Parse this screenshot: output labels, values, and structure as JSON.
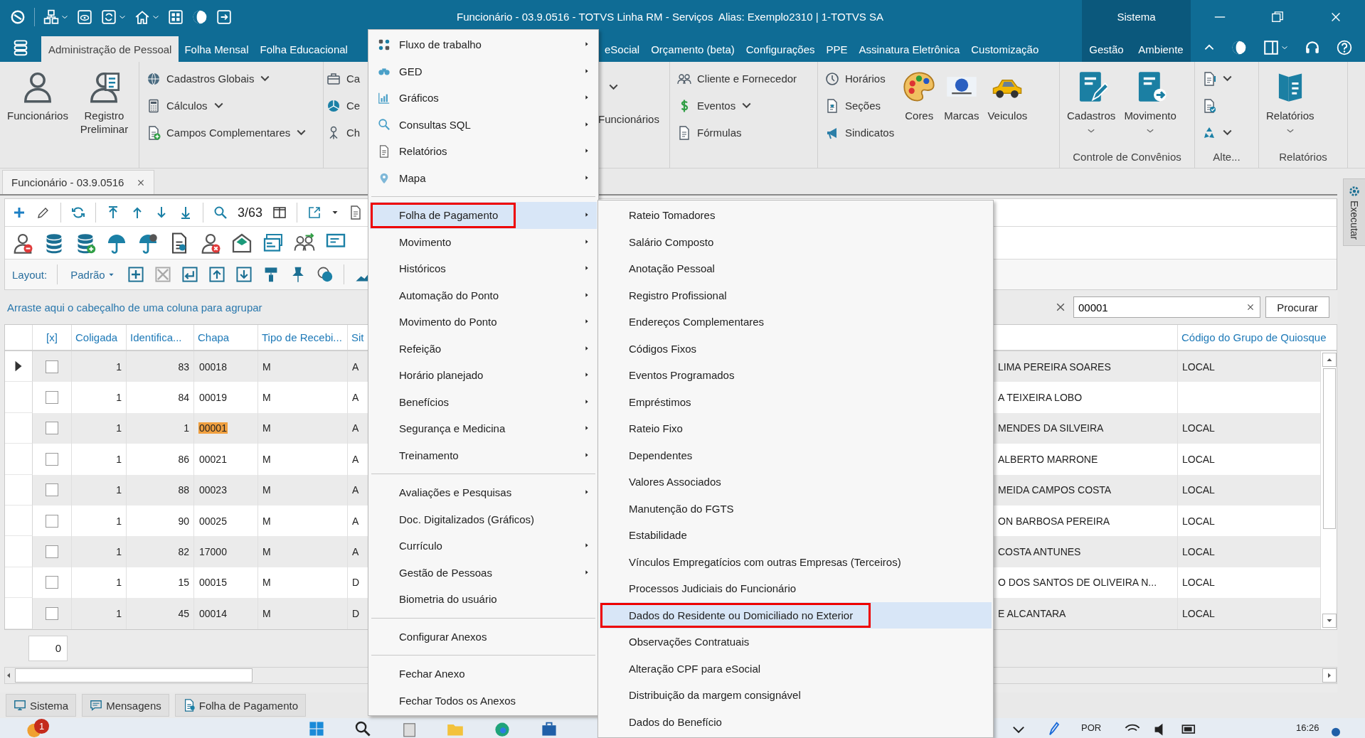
{
  "title_bar": {
    "title": "Funcionário - 03.9.0516 - TOTVS Linha RM - Serviços  Alias: Exemplo2310 | 1-TOTVS SA",
    "section": "Sistema"
  },
  "menu_tabs": [
    {
      "label": "Administração de Pessoal",
      "selected": true
    },
    {
      "label": "Folha Mensal",
      "selected": false
    },
    {
      "label": "Folha Educacional",
      "selected": false
    },
    {
      "label": "eSocial",
      "selected": false
    },
    {
      "label": "Orçamento (beta)",
      "selected": false
    },
    {
      "label": "Configurações",
      "selected": false
    },
    {
      "label": "PPE",
      "selected": false
    },
    {
      "label": "Assinatura Eletrônica",
      "selected": false
    },
    {
      "label": "Customização",
      "selected": false
    }
  ],
  "system_tabs": [
    {
      "label": "Gestão"
    },
    {
      "label": "Ambiente"
    }
  ],
  "ribbon": {
    "groups": [
      {
        "items": [
          {
            "label": "Funcionários",
            "kind": "large",
            "dropdown": false
          },
          {
            "label": "Registro Preliminar",
            "kind": "large",
            "dropdown": false
          }
        ]
      },
      {
        "items": [
          {
            "label": "Cadastros Globais",
            "kind": "small",
            "dropdown": true
          },
          {
            "label": "Cálculos",
            "kind": "small",
            "dropdown": true
          },
          {
            "label": "Campos Complementares",
            "kind": "small",
            "dropdown": true
          }
        ]
      },
      {
        "items": [
          {
            "label": "Ca",
            "kind": "small"
          },
          {
            "label": "Ce",
            "kind": "small",
            "dropdown": false
          },
          {
            "label": "Ch",
            "kind": "small",
            "dropdown": false
          },
          {
            "label": "Funcionários",
            "kind": "caption",
            "dropdown": true
          }
        ]
      },
      {
        "items": [
          {
            "label": "Cliente e Fornecedor",
            "kind": "small",
            "dropdown": false
          },
          {
            "label": "Eventos",
            "kind": "small",
            "dropdown": true
          },
          {
            "label": "Fórmulas",
            "kind": "small",
            "dropdown": false
          }
        ]
      },
      {
        "items": [
          {
            "label": "Horários",
            "kind": "small",
            "dropdown": false
          },
          {
            "label": "Seções",
            "kind": "small",
            "dropdown": false
          },
          {
            "label": "Sindicatos",
            "kind": "small",
            "dropdown": false
          },
          {
            "label": "Cores",
            "kind": "large",
            "dropdown": false
          },
          {
            "label": "Marcas",
            "kind": "large",
            "dropdown": false
          },
          {
            "label": "Veiculos",
            "kind": "large",
            "dropdown": false
          }
        ]
      },
      {
        "label": "Controle de Convênios",
        "items": [
          {
            "label": "Cadastros",
            "kind": "large",
            "dropdown": true
          },
          {
            "label": "Movimento",
            "kind": "large",
            "dropdown": true
          }
        ]
      },
      {
        "label": "Alte...",
        "items": [
          {
            "kind": "small",
            "dropdown": true
          },
          {
            "kind": "small",
            "dropdown": false
          },
          {
            "kind": "small",
            "dropdown": true
          }
        ]
      },
      {
        "label": "Relatórios",
        "items": [
          {
            "label": "Relatórios",
            "kind": "large",
            "dropdown": true
          }
        ]
      }
    ]
  },
  "document_tab": {
    "label": "Funcionário - 03.9.0516"
  },
  "toolbar": {
    "position": "3/63",
    "layout_label": "Layout:",
    "layout": "Padrão"
  },
  "group_hint": "Arraste aqui o cabeçalho de uma coluna para agrupar",
  "search": {
    "value": "00001",
    "button": "Procurar"
  },
  "grid": {
    "columns": [
      {
        "label": "[x]"
      },
      {
        "label": "Coligada"
      },
      {
        "label": "Identifica..."
      },
      {
        "label": "Chapa"
      },
      {
        "label": "Tipo de Recebi..."
      },
      {
        "label": "Sit"
      },
      {
        "label": "Código do Grupo de Quiosque"
      }
    ],
    "rows": [
      {
        "current": true,
        "checked": false,
        "match": false,
        "coligada": "1",
        "identifica": "83",
        "chapa": "00018",
        "tipo": "M",
        "situ": "A",
        "column_7": "LIMA PEREIRA SOARES",
        "quiosque": "LOCAL"
      },
      {
        "current": false,
        "checked": false,
        "match": false,
        "coligada": "1",
        "identifica": "84",
        "chapa": "00019",
        "tipo": "M",
        "situ": "A",
        "column_7": "A TEIXEIRA LOBO"
      },
      {
        "current": false,
        "checked": false,
        "match": true,
        "coligada": "1",
        "identifica": "1",
        "chapa": "00001",
        "tipo": "M",
        "situ": "A",
        "column_7": "MENDES DA SILVEIRA",
        "quiosque": "LOCAL"
      },
      {
        "current": false,
        "checked": false,
        "match": false,
        "coligada": "1",
        "identifica": "86",
        "chapa": "00021",
        "tipo": "M",
        "situ": "A",
        "column_7": "ALBERTO MARRONE",
        "quiosque": "LOCAL"
      },
      {
        "current": false,
        "checked": false,
        "match": false,
        "coligada": "1",
        "identifica": "88",
        "chapa": "00023",
        "tipo": "M",
        "situ": "A",
        "column_7": "MEIDA CAMPOS COSTA",
        "quiosque": "LOCAL"
      },
      {
        "current": false,
        "checked": false,
        "match": false,
        "coligada": "1",
        "identifica": "90",
        "chapa": "00025",
        "tipo": "M",
        "situ": "A",
        "column_7": "ON BARBOSA PEREIRA",
        "quiosque": "LOCAL"
      },
      {
        "current": false,
        "checked": false,
        "match": false,
        "coligada": "1",
        "identifica": "82",
        "chapa": "17000",
        "tipo": "M",
        "situ": "A",
        "column_7": "COSTA ANTUNES",
        "quiosque": "LOCAL"
      },
      {
        "current": false,
        "checked": false,
        "match": false,
        "coligada": "1",
        "identifica": "15",
        "chapa": "00015",
        "tipo": "M",
        "situ": "D",
        "column_7": "O DOS SANTOS DE OLIVEIRA N...",
        "quiosque": "LOCAL"
      },
      {
        "current": false,
        "checked": false,
        "match": false,
        "coligada": "1",
        "identifica": "45",
        "chapa": "00014",
        "tipo": "M",
        "situ": "D",
        "column_7": "E ALCANTARA",
        "quiosque": "LOCAL"
      }
    ]
  },
  "record_count": "0",
  "bottom_tabs": [
    {
      "label": "Sistema"
    },
    {
      "label": "Mensagens"
    },
    {
      "label": "Folha de Pagamento"
    }
  ],
  "side_tab": "Executar",
  "taskbar": {
    "badge": "1",
    "language": "POR",
    "time": "16:26"
  },
  "context_menu": {
    "sections": [
      {
        "items": [
          {
            "label": "Fluxo de trabalho",
            "submenu": true,
            "highlighted": false,
            "outlined": false
          },
          {
            "label": "GED",
            "submenu": true,
            "highlighted": false,
            "outlined": false
          },
          {
            "label": "Gráficos",
            "submenu": true,
            "highlighted": false,
            "outlined": false
          },
          {
            "label": "Consultas SQL",
            "submenu": true,
            "highlighted": false,
            "outlined": false
          },
          {
            "label": "Relatórios",
            "submenu": true,
            "highlighted": false,
            "outlined": false
          },
          {
            "label": "Mapa",
            "submenu": true,
            "highlighted": false,
            "outlined": false
          }
        ]
      },
      {
        "items": [
          {
            "label": "Folha de Pagamento",
            "submenu": true,
            "highlighted": true,
            "outlined": true
          },
          {
            "label": "Movimento",
            "submenu": true,
            "highlighted": false,
            "outlined": false
          },
          {
            "label": "Históricos",
            "submenu": true,
            "highlighted": false,
            "outlined": false
          },
          {
            "label": "Automação do Ponto",
            "submenu": true,
            "highlighted": false,
            "outlined": false
          },
          {
            "label": "Movimento do Ponto",
            "submenu": true,
            "highlighted": false,
            "outlined": false
          },
          {
            "label": "Refeição",
            "submenu": true,
            "highlighted": false,
            "outlined": false
          },
          {
            "label": "Horário planejado",
            "submenu": true,
            "highlighted": false,
            "outlined": false
          },
          {
            "label": "Benefícios",
            "submenu": true,
            "highlighted": false,
            "outlined": false
          },
          {
            "label": "Segurança e Medicina",
            "submenu": true,
            "highlighted": false,
            "outlined": false
          },
          {
            "label": "Treinamento",
            "submenu": true,
            "highlighted": false,
            "outlined": false
          }
        ]
      },
      {
        "items": [
          {
            "label": "Avaliações e Pesquisas",
            "submenu": true,
            "highlighted": false,
            "outlined": false
          },
          {
            "label": "Doc. Digitalizados (Gráficos)",
            "submenu": false,
            "highlighted": false,
            "outlined": false
          },
          {
            "label": "Currículo",
            "submenu": true,
            "highlighted": false,
            "outlined": false
          },
          {
            "label": "Gestão de Pessoas",
            "submenu": true,
            "highlighted": false,
            "outlined": false
          },
          {
            "label": "Biometria do usuário",
            "submenu": false,
            "highlighted": false,
            "outlined": false
          }
        ]
      },
      {
        "items": [
          {
            "label": "Configurar Anexos",
            "submenu": false,
            "highlighted": false,
            "outlined": false
          }
        ]
      },
      {
        "items": [
          {
            "label": "Fechar Anexo",
            "submenu": false,
            "highlighted": false,
            "outlined": false
          },
          {
            "label": "Fechar Todos os Anexos",
            "submenu": false,
            "highlighted": false,
            "outlined": false
          }
        ]
      }
    ]
  },
  "submenu": {
    "items": [
      {
        "label": "Rateio Tomadores",
        "highlighted": false,
        "outlined": false
      },
      {
        "label": "Salário Composto",
        "highlighted": false,
        "outlined": false
      },
      {
        "label": "Anotação Pessoal",
        "highlighted": false,
        "outlined": false
      },
      {
        "label": "Registro Profissional",
        "highlighted": false,
        "outlined": false
      },
      {
        "label": "Endereços Complementares",
        "highlighted": false,
        "outlined": false
      },
      {
        "label": "Códigos Fixos",
        "highlighted": false,
        "outlined": false
      },
      {
        "label": "Eventos Programados",
        "highlighted": false,
        "outlined": false
      },
      {
        "label": "Empréstimos",
        "highlighted": false,
        "outlined": false
      },
      {
        "label": "Rateio Fixo",
        "highlighted": false,
        "outlined": false
      },
      {
        "label": "Dependentes",
        "highlighted": false,
        "outlined": false
      },
      {
        "label": "Valores Associados",
        "highlighted": false,
        "outlined": false
      },
      {
        "label": "Manutenção do FGTS",
        "highlighted": false,
        "outlined": false
      },
      {
        "label": "Estabilidade",
        "highlighted": false,
        "outlined": false
      },
      {
        "label": "Vínculos Empregatícios com outras Empresas (Terceiros)",
        "highlighted": false,
        "outlined": false
      },
      {
        "label": "Processos Judiciais do Funcionário",
        "highlighted": false,
        "outlined": false
      },
      {
        "label": "Dados do Residente ou Domiciliado no Exterior",
        "highlighted": true,
        "outlined": true
      },
      {
        "label": "Observações Contratuais",
        "highlighted": false,
        "outlined": false
      },
      {
        "label": "Alteração CPF para eSocial",
        "highlighted": false,
        "outlined": false
      },
      {
        "label": "Distribuição da margem consignável",
        "highlighted": false,
        "outlined": false
      },
      {
        "label": "Dados do Benefício",
        "highlighted": false,
        "outlined": false
      }
    ]
  }
}
